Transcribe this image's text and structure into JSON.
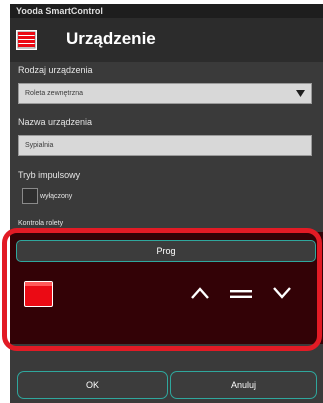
{
  "app": {
    "window_title": "Yooda SmartControl"
  },
  "header": {
    "icon": "blind-icon",
    "title": "Urządzenie"
  },
  "form": {
    "device_type": {
      "label": "Rodzaj urządzenia",
      "value": "Roleta zewnętrzna",
      "arrow_icon": "triangle-down-icon"
    },
    "device_name": {
      "label": "Nazwa urządzenia",
      "value": "Sypialnia"
    },
    "impulse_mode": {
      "label": "Tryb impulsowy",
      "checkbox_label": "wyłączony",
      "checked": false
    },
    "blind_control": {
      "label": "Kontrola rolety"
    }
  },
  "control": {
    "prog_label": "Prog",
    "blind_icon": "blind-state-icon",
    "up_icon": "chevron-up-icon",
    "stop_icon": "equals-icon",
    "down_icon": "chevron-down-icon"
  },
  "footer": {
    "ok_label": "OK",
    "cancel_label": "Anuluj"
  },
  "colors": {
    "accent": "#2fa79d",
    "highlight": "#e21b25",
    "blind_red": "#eb0a14",
    "panel": "#330206"
  }
}
